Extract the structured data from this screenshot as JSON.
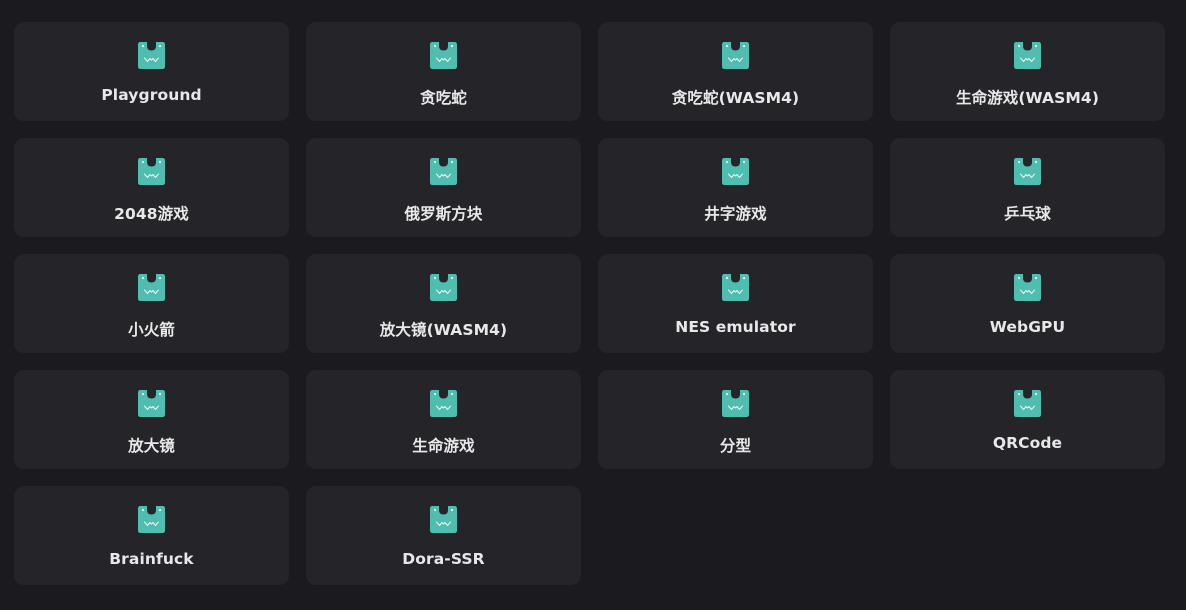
{
  "accent_color": "#4fbdb0",
  "icon_name": "wasm-logo-icon",
  "projects": [
    {
      "label": "Playground"
    },
    {
      "label": "贪吃蛇"
    },
    {
      "label": "贪吃蛇(WASM4)"
    },
    {
      "label": "生命游戏(WASM4)"
    },
    {
      "label": "2048游戏"
    },
    {
      "label": "俄罗斯方块"
    },
    {
      "label": "井字游戏"
    },
    {
      "label": "乒乓球"
    },
    {
      "label": "小火箭"
    },
    {
      "label": "放大镜(WASM4)"
    },
    {
      "label": "NES emulator"
    },
    {
      "label": "WebGPU"
    },
    {
      "label": "放大镜"
    },
    {
      "label": "生命游戏"
    },
    {
      "label": "分型"
    },
    {
      "label": "QRCode"
    },
    {
      "label": "Brainfuck"
    },
    {
      "label": "Dora-SSR"
    }
  ]
}
